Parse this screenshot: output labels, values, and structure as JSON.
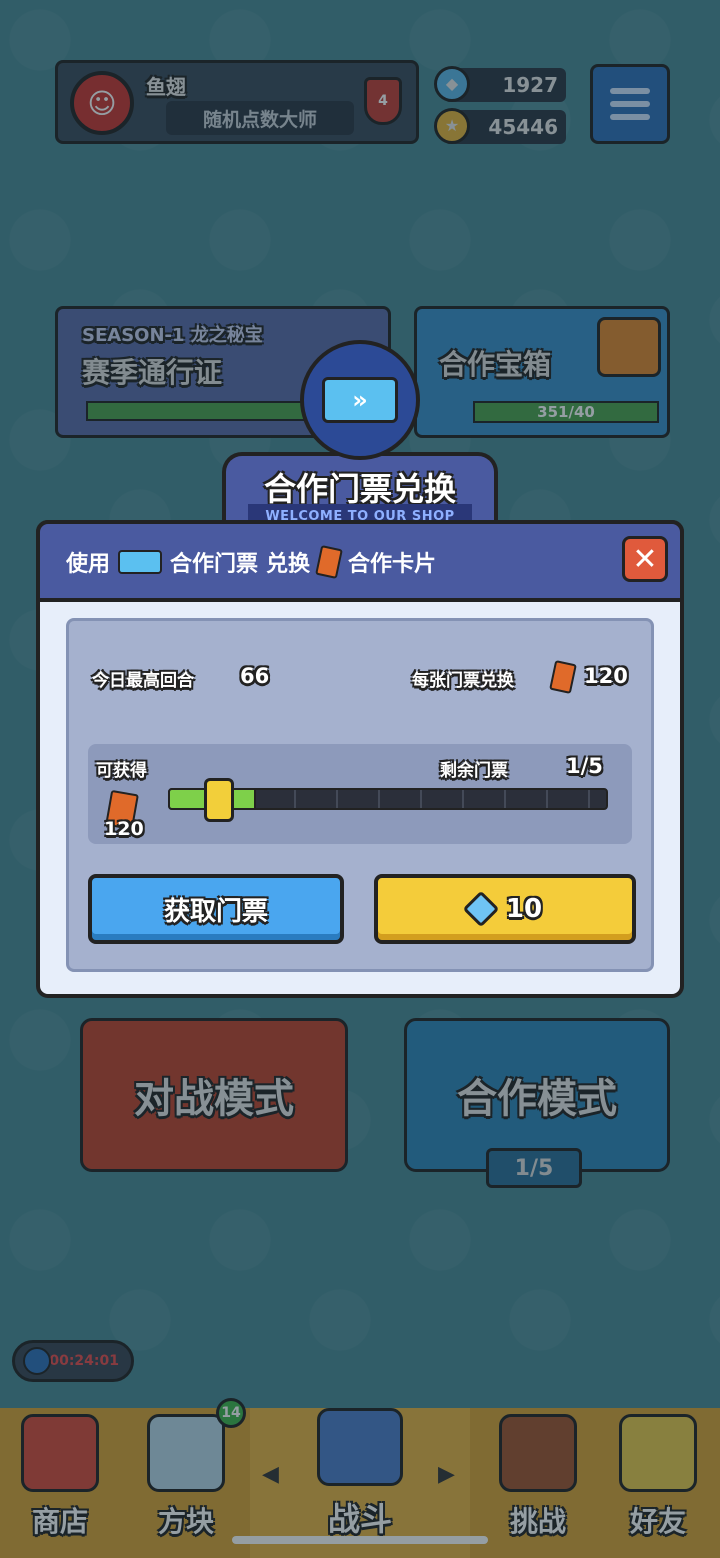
{
  "player": {
    "name": "鱼翅",
    "title": "随机点数大师",
    "rank": "4"
  },
  "currency": {
    "gems": "1927",
    "gold": "45446"
  },
  "cards": {
    "season_label": "SEASON-1 龙之秘宝",
    "season_title": "赛季通行证",
    "coop_chest_title": "合作宝箱",
    "coop_chest_progress": "351/40"
  },
  "modes": {
    "battle": "对战模式",
    "coop": "合作模式",
    "coop_count": "1/5"
  },
  "modal": {
    "title": "合作门票兑换",
    "subtitle": "WELCOME TO OUR SHOP",
    "use_label": "使用",
    "ticket_label": "合作门票",
    "exchange_label": "兑换",
    "card_label": "合作卡片",
    "today_best_label": "今日最高回合",
    "today_best_value": "66",
    "per_ticket_label": "每张门票兑换",
    "per_ticket_value": "120",
    "obtainable_label": "可获得",
    "obtainable_value": "120",
    "remaining_label": "剩余门票",
    "remaining_value": "1/5",
    "slider_fraction": 0.2,
    "get_ticket_button": "获取门票",
    "buy_price": "10"
  },
  "timer": "00:24:01",
  "nav": {
    "badge_count": "14",
    "items": [
      {
        "label": "商店"
      },
      {
        "label": "方块"
      },
      {
        "label": "战斗"
      },
      {
        "label": "挑战"
      },
      {
        "label": "好友"
      }
    ]
  }
}
